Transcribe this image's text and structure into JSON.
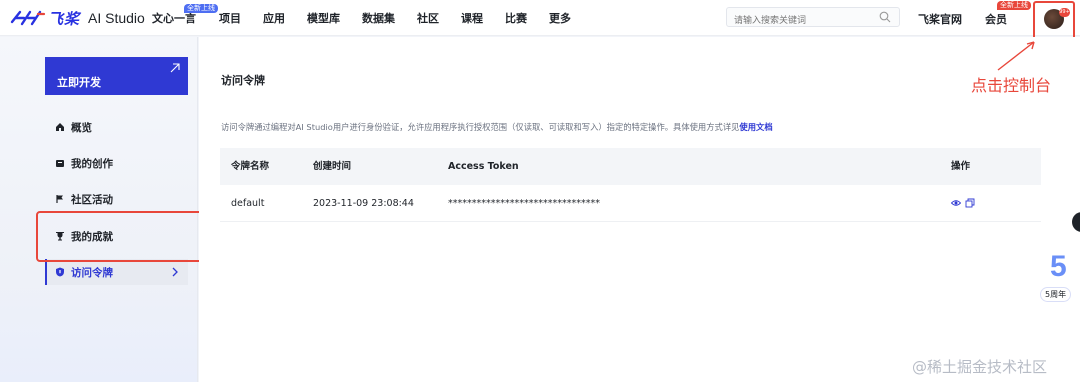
{
  "nav": {
    "logo_cn": "飞桨",
    "logo_en": "AI Studio",
    "items": [
      {
        "label": "文心一言",
        "badge": "全新上线"
      },
      {
        "label": "项目"
      },
      {
        "label": "应用"
      },
      {
        "label": "模型库"
      },
      {
        "label": "数据集"
      },
      {
        "label": "社区"
      },
      {
        "label": "课程"
      },
      {
        "label": "比赛"
      },
      {
        "label": "更多"
      }
    ],
    "search_placeholder": "请输入搜索关键词",
    "paddle_official": "飞桨官网",
    "membership": "会员",
    "membership_badge": "全新上线",
    "avatar_badge": "99+"
  },
  "sidebar": {
    "develop_button": "立即开发",
    "items": [
      {
        "label": "概览",
        "icon": "home-icon"
      },
      {
        "label": "我的创作",
        "icon": "folder-icon"
      },
      {
        "label": "社区活动",
        "icon": "flag-icon"
      },
      {
        "label": "我的成就",
        "icon": "trophy-icon"
      },
      {
        "label": "访问令牌",
        "icon": "shield-icon",
        "active": true
      }
    ]
  },
  "main": {
    "title": "访问令牌",
    "description": "访问令牌通过编程对AI Studio用户进行身份验证，允许应用程序执行授权范围（仅读取、可读取和写入）指定的特定操作。具体使用方式详见",
    "doc_link": "使用文档",
    "table": {
      "headers": [
        "令牌名称",
        "创建时间",
        "Access Token",
        "操作"
      ],
      "rows": [
        {
          "name": "default",
          "created": "2023-11-09 23:08:44",
          "token": "********************************"
        }
      ]
    }
  },
  "annotation": {
    "text": "点击控制台",
    "color": "#e8473b"
  },
  "anniversary": {
    "number": "5",
    "label": "5周年"
  },
  "watermark": "@稀土掘金技术社区",
  "colors": {
    "accent": "#2f39d3",
    "annotation_red": "#e8473b"
  }
}
